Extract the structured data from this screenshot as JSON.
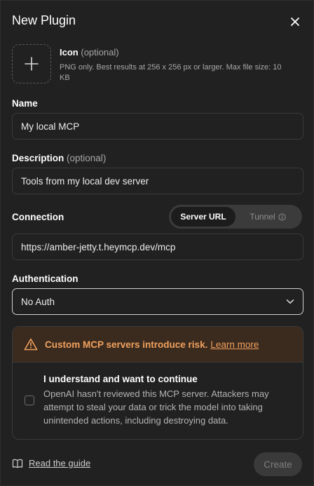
{
  "dialog": {
    "title": "New Plugin"
  },
  "icon_upload": {
    "label": "Icon",
    "optional": "(optional)",
    "help": "PNG only. Best results at 256 x 256 px or larger. Max file size: 10 KB"
  },
  "name": {
    "label": "Name",
    "value": "My local MCP"
  },
  "description": {
    "label": "Description",
    "optional": "(optional)",
    "value": "Tools from my local dev server"
  },
  "connection": {
    "label": "Connection",
    "options": [
      "Server URL",
      "Tunnel"
    ],
    "selected": "Server URL",
    "url": "https://amber-jetty.t.heymcp.dev/mcp"
  },
  "authentication": {
    "label": "Authentication",
    "value": "No Auth"
  },
  "warning": {
    "message": "Custom MCP servers introduce risk.",
    "link": "Learn more",
    "consent_title": "I understand and want to continue",
    "consent_text": "OpenAI hasn't reviewed this MCP server. Attackers may attempt to steal your data or trick the model into taking unintended actions, including destroying data."
  },
  "footer": {
    "guide_link": "Read the guide",
    "create_button": "Create"
  },
  "colors": {
    "background": "#212121",
    "warning_bg": "#3b2a1e",
    "warning_text": "#f0a15e",
    "create_disabled_bg": "#3a3a3a"
  },
  "icons": {
    "close": "close-icon",
    "upload": "plus-icon",
    "tunnel_info": "info-icon",
    "select_chevron": "chevron-down-icon",
    "warning": "warning-triangle-icon",
    "guide": "book-icon"
  }
}
